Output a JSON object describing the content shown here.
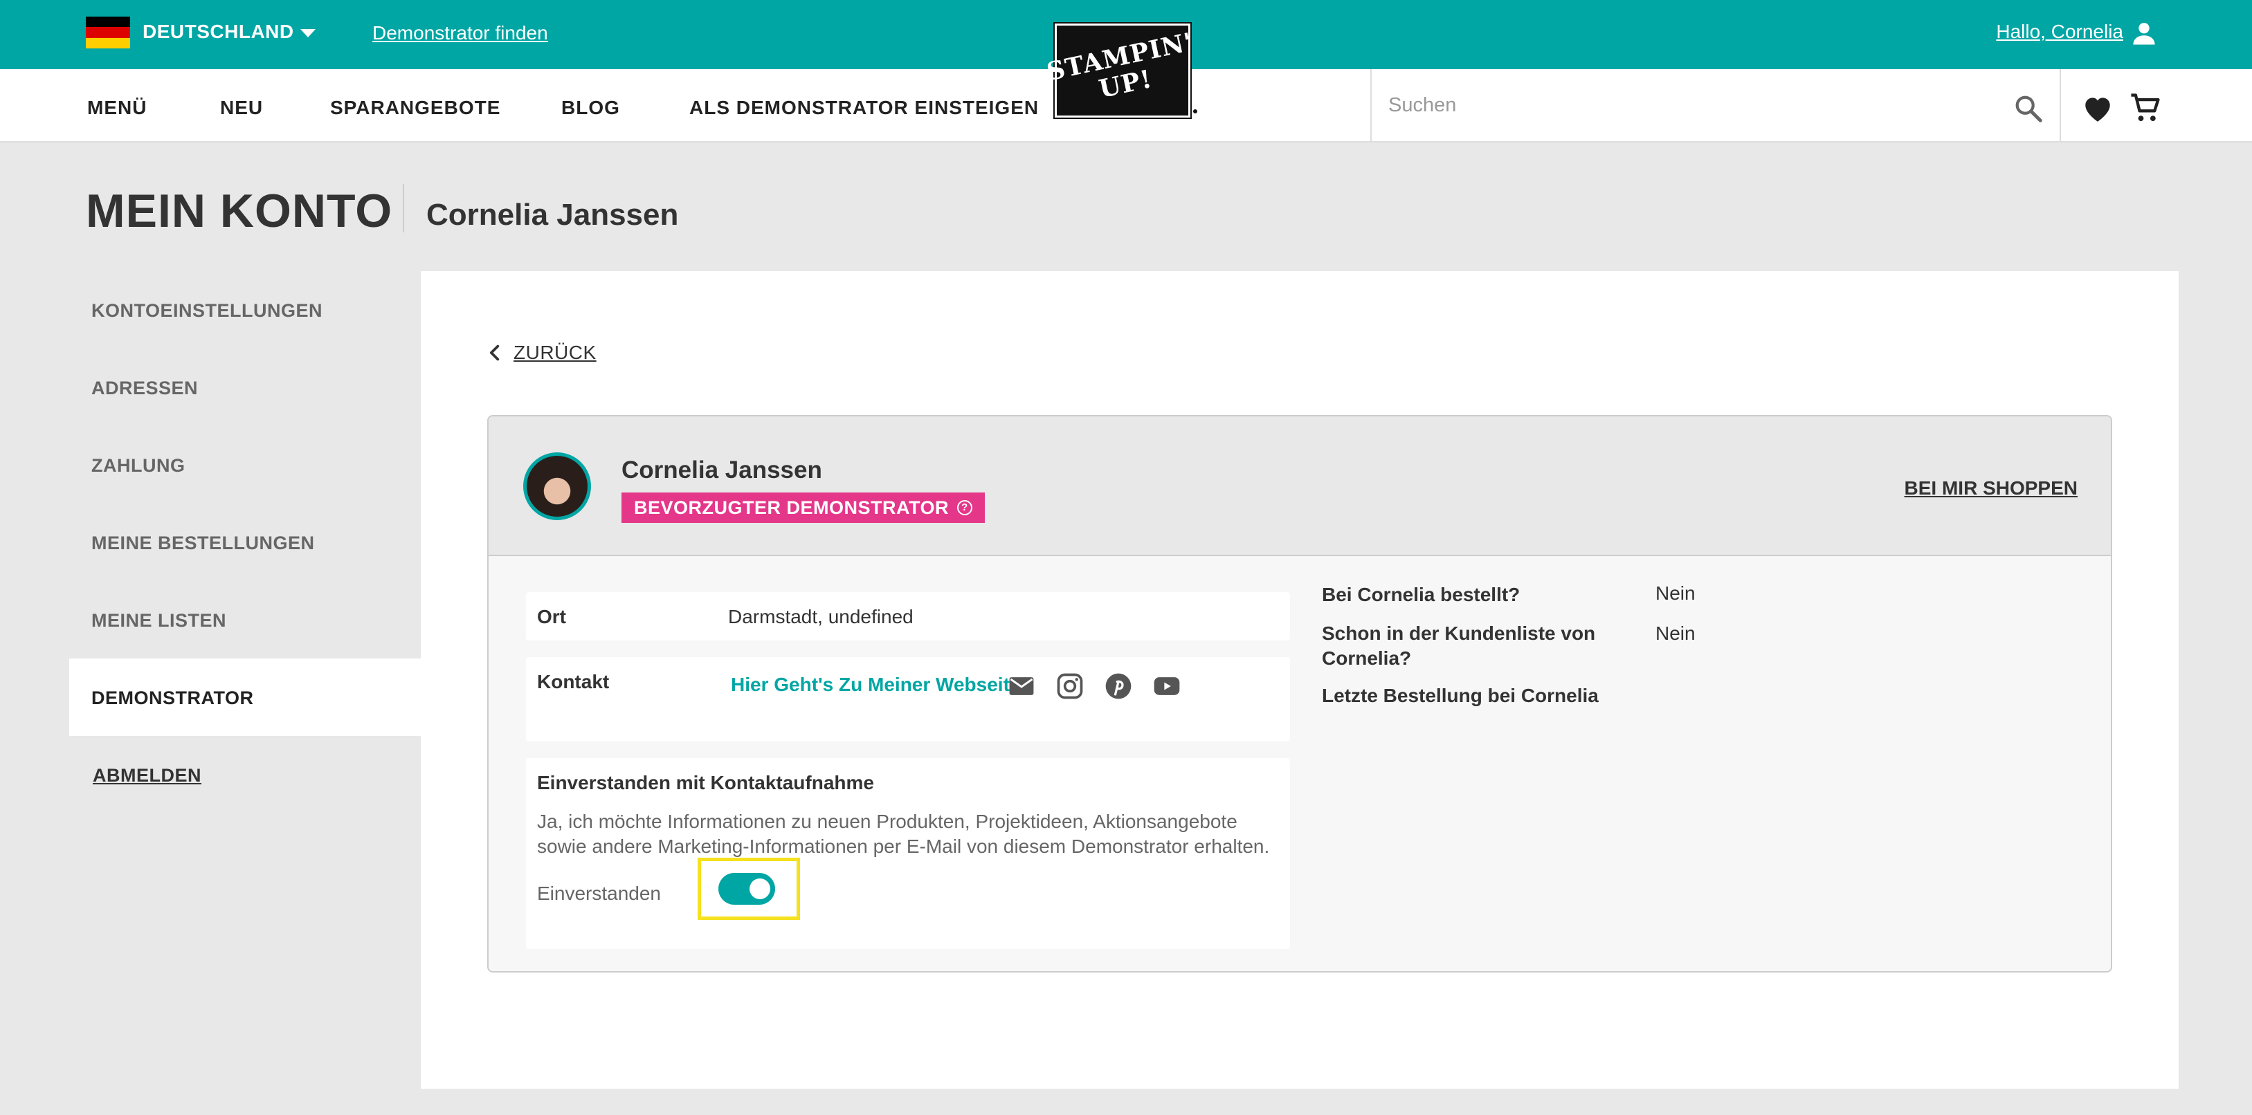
{
  "topbar": {
    "country": "DEUTSCHLAND",
    "find_demonstrator": "Demonstrator finden",
    "greeting": "Hallo, Cornelia"
  },
  "logo": {
    "line1": "STAMPIN'",
    "line2": "UP!"
  },
  "nav": {
    "items": [
      "MENÜ",
      "NEU",
      "SPARANGEBOTE",
      "BLOG",
      "ALS DEMONSTRATOR EINSTEIGEN"
    ],
    "search_placeholder": "Suchen"
  },
  "page": {
    "title": "MEIN KONTO",
    "subtitle": "Cornelia Janssen"
  },
  "sidebar": {
    "items": [
      "KONTOEINSTELLUNGEN",
      "ADRESSEN",
      "ZAHLUNG",
      "MEINE BESTELLUNGEN",
      "MEINE LISTEN",
      "DEMONSTRATOR"
    ],
    "active": "DEMONSTRATOR",
    "logout": "ABMELDEN"
  },
  "main": {
    "back": "ZURÜCK",
    "card": {
      "name": "Cornelia Janssen",
      "badge": "BEVORZUGTER DEMONSTRATOR",
      "shop_link": "BEI MIR SHOPPEN",
      "location_label": "Ort",
      "location_value": "Darmstadt, undefined",
      "contact_label": "Kontakt",
      "website_link": "Hier Geht's Zu Meiner Webseite",
      "consent_title": "Einverstanden mit Kontaktaufnahme",
      "consent_text": "Ja, ich möchte Informationen zu neuen Produkten, Projektideen, Aktionsangebote sowie andere Marketing-Informationen per E-Mail von diesem Demonstrator erhalten.",
      "consent_label": "Einverstanden",
      "consent_enabled": true,
      "stats": [
        {
          "label": "Bei Cornelia bestellt?",
          "value": "Nein"
        },
        {
          "label": "Schon in der Kundenliste von Cornelia?",
          "value": "Nein"
        },
        {
          "label": "Letzte Bestellung bei Cornelia",
          "value": ""
        }
      ]
    }
  },
  "colors": {
    "brand_teal": "#00a6a4",
    "badge_pink": "#e4378a",
    "highlight_yellow": "#f5e11e"
  }
}
